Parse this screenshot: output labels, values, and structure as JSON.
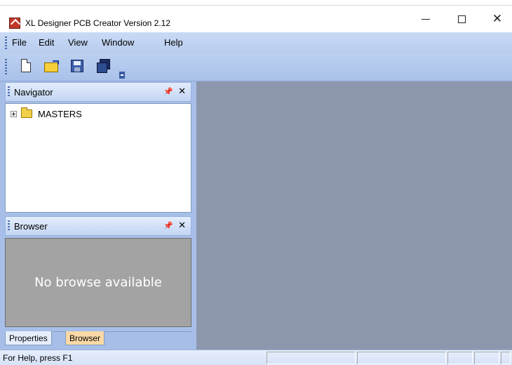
{
  "window": {
    "title": "XL Designer PCB Creator Version 2.12",
    "icon": "app-icon",
    "controls": [
      "minimize",
      "maximize",
      "close"
    ]
  },
  "menubar": {
    "items": [
      "File",
      "Edit",
      "View",
      "Window",
      "Help"
    ]
  },
  "toolbar": {
    "buttons": [
      "new-document-icon",
      "open-folder-icon",
      "save-icon",
      "save-all-icon"
    ]
  },
  "navigator": {
    "title": "Navigator",
    "tree": [
      {
        "label": "MASTERS",
        "expandable": true
      }
    ]
  },
  "browser": {
    "title": "Browser",
    "message": "No browse available"
  },
  "tabs": {
    "items": [
      "Properties",
      "Browser"
    ],
    "active": "Browser"
  },
  "statusbar": {
    "text": "For Help, press F1"
  },
  "colors": {
    "workspace": "#8c97ad",
    "menubar": "#c9daf6",
    "active_tab": "#fbd9a6"
  }
}
